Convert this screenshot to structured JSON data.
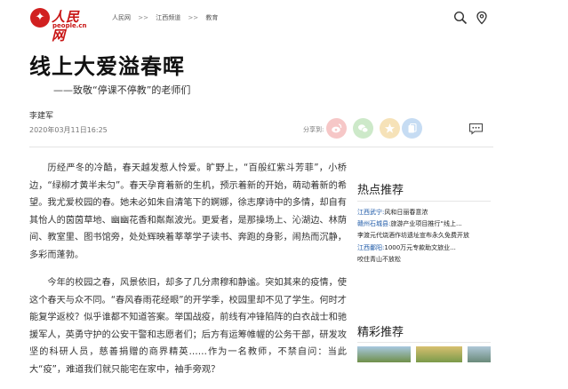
{
  "header": {
    "logo_text": "人民网",
    "logo_sub": "people.cn",
    "breadcrumbs": [
      "人民网",
      "江西频道",
      "教育"
    ],
    "separator": ">>"
  },
  "article": {
    "title": "线上大爱溢春晖",
    "subtitle": "——致敬“停课不停教”的老师们",
    "author": "李建军",
    "date": "2020年03月11日16:25",
    "share_label": "分享到:",
    "paragraphs": [
      "历经严冬的冷酷，春天越发惹人怜爱。旷野上，“百般红紫斗芳菲”，小桥边，“绿柳才黄半未匀”。春天孕育着新的生机，预示着新的开始，萌动着新的希望。我尤爱校园的春。她未必如朱自清笔下的婀娜，徐志摩诗中的多情，却自有其怡人的茵茵草地、幽幽花香和粼粼波光。更爱者，是那操场上、沁湖边、林荫间、教室里、图书馆旁，处处辉映着莘莘学子读书、奔跑的身影，闹热而沉静，多彩而蓬勃。",
      "今年的校园之春，风景依旧，却多了几分肃穆和静谧。突如其来的疫情，使这个春天与众不同。“春风春雨花经眼”的开学季，校园里却不见了学生。何时才能复学返校？似乎谁都不知道答案。举国战疫，前线有冲锋陷阵的白衣战士和驰援军人，英勇守护的公安干警和志愿者们；后方有运筹帷幄的公务干部，研发攻坚的科研人员，慈善捐赠的商界精英……作为一名教师，不禁自问：当此大“疫”，难道我们就只能宅在家中，袖手旁观？"
    ]
  },
  "sidebar": {
    "hot_title": "热点推荐",
    "hot_items": [
      {
        "tag": "江西武宁:",
        "text": "风和日丽春意浓"
      },
      {
        "tag": "赣州石城县:",
        "text": "旅游产业项目推行“线上..."
      },
      {
        "tag": "",
        "text": "李渡元代烧酒作坊遗址宣布永久免费开放"
      },
      {
        "tag": "江西鄱阳:",
        "text": "1000万元专款助文旅业..."
      },
      {
        "tag": "",
        "text": "咬住青山不放松"
      }
    ],
    "featured_title": "精彩推荐"
  },
  "colors": {
    "brand_red": "#c81414",
    "share_weibo": "#f6c7c7",
    "share_wechat": "#cde9c9",
    "share_qzone": "#f6e2b8",
    "share_copy": "#c6dcf3",
    "link_blue": "#1e5aa8"
  }
}
